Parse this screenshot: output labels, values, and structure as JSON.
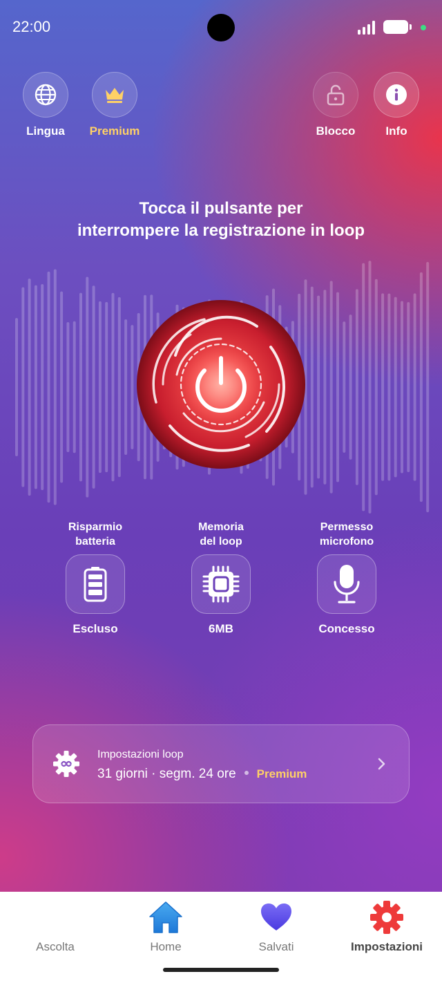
{
  "status_bar": {
    "time": "22:00"
  },
  "top_actions": [
    {
      "label": "Lingua",
      "icon": "globe-icon"
    },
    {
      "label": "Premium",
      "icon": "crown-icon"
    },
    {
      "label": "Blocco",
      "icon": "lock-open-icon"
    },
    {
      "label": "Info",
      "icon": "info-icon"
    }
  ],
  "headline": {
    "line1": "Tocca il pulsante per",
    "line2": "interrompere la registrazione in loop"
  },
  "status_items": [
    {
      "title1": "Risparmio",
      "title2": "batteria",
      "value": "Escluso",
      "icon": "battery-icon"
    },
    {
      "title1": "Memoria",
      "title2": "del loop",
      "value": "6MB",
      "icon": "chip-icon"
    },
    {
      "title1": "Permesso",
      "title2": "microfono",
      "value": "Concesso",
      "icon": "microphone-icon"
    }
  ],
  "loop_settings": {
    "title": "Impostazioni loop",
    "subtitle": "31 giorni · segm. 24 ore",
    "badge": "Premium"
  },
  "bottom_nav": [
    {
      "label": "Ascolta",
      "icon": "waveform-icon",
      "active": false
    },
    {
      "label": "Home",
      "icon": "home-icon",
      "active": false
    },
    {
      "label": "Salvati",
      "icon": "heart-icon",
      "active": false
    },
    {
      "label": "Impostazioni",
      "icon": "gear-icon",
      "active": true
    }
  ],
  "colors": {
    "accent_gold": "#ffd166",
    "record_red": "#e02030",
    "nav_blue": "#2a8ce0",
    "nav_purple": "#5a4fe8"
  }
}
